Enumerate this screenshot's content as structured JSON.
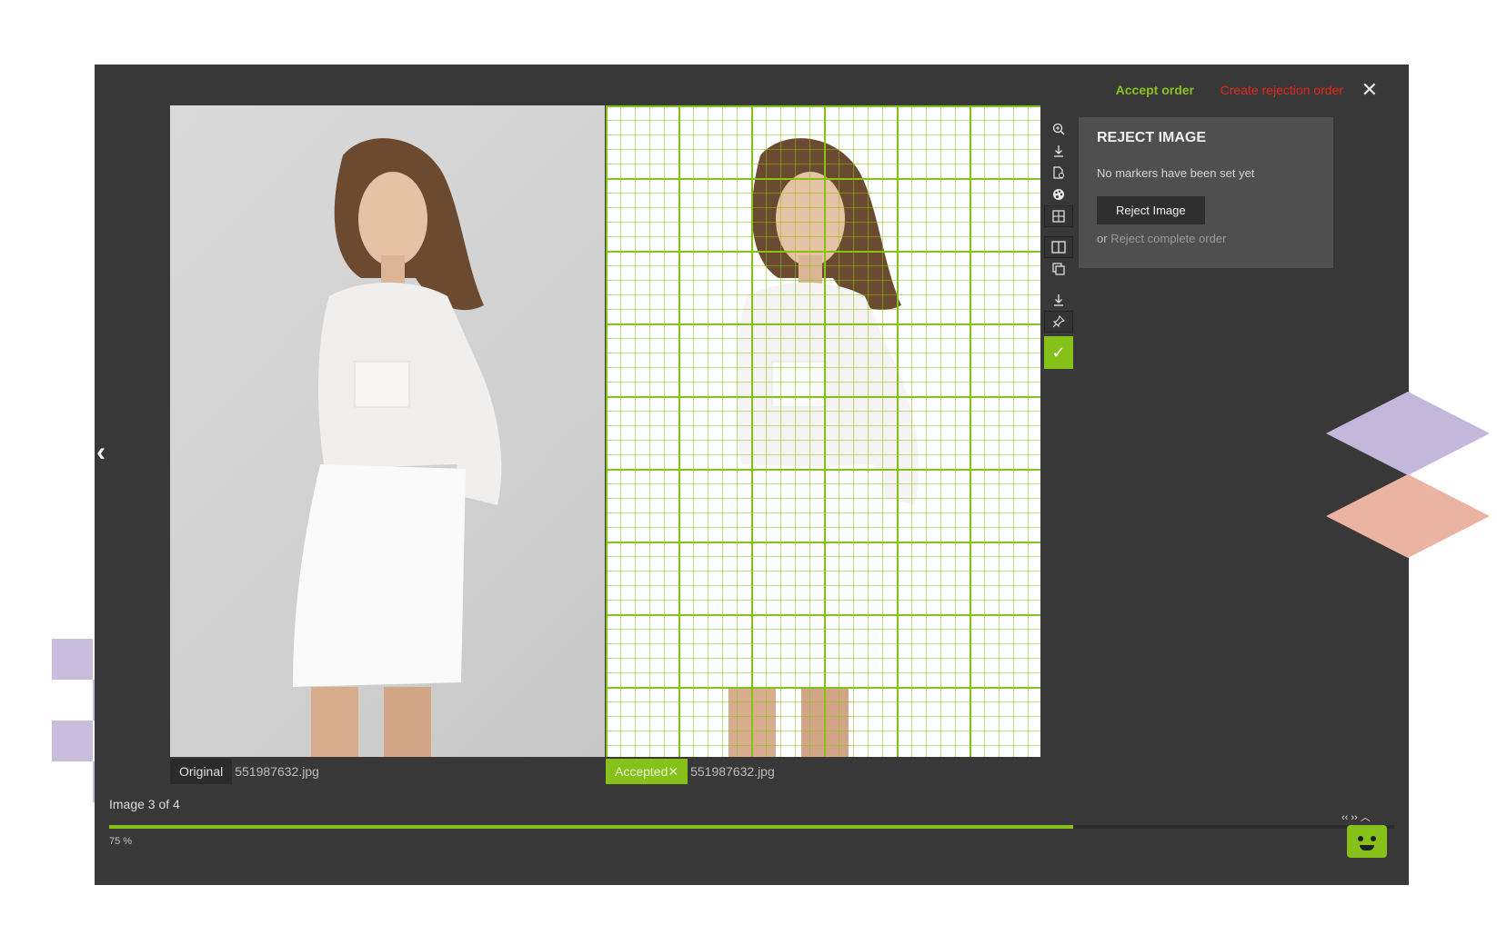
{
  "header": {
    "accept_order": "Accept order",
    "create_rejection_order": "Create rejection order",
    "close_icon": "close-icon"
  },
  "left_image": {
    "tag": "Original",
    "filename": "551987632.jpg"
  },
  "right_image": {
    "tag": "Accepted✕",
    "filename": "551987632.jpg"
  },
  "toolbar": {
    "icons": [
      "zoom-in-icon",
      "download-icon",
      "document-icon",
      "palette-icon",
      "grid-icon",
      "split-view-icon",
      "overlay-view-icon",
      "download-icon",
      "pin-icon",
      "check-icon"
    ]
  },
  "reject_panel": {
    "title": "REJECT IMAGE",
    "message": "No markers have been set yet",
    "button": "Reject Image",
    "or_text": "or",
    "link": "Reject complete order"
  },
  "progress": {
    "label": "Image 3 of 4",
    "percent_text": "75 %",
    "value": 0.75
  },
  "colors": {
    "accent": "#86c11a",
    "danger": "#e8261a",
    "background": "#383838"
  }
}
